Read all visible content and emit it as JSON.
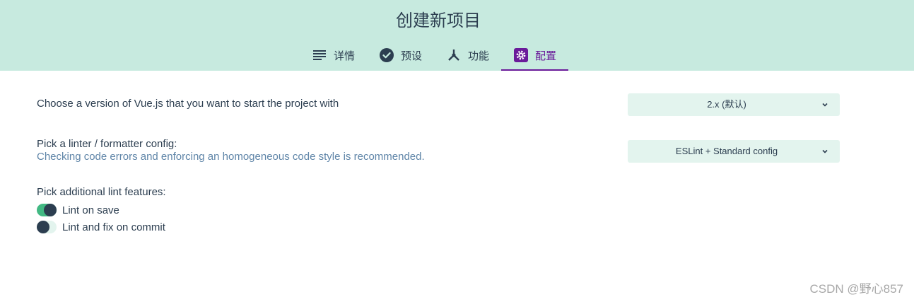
{
  "header": {
    "title": "创建新项目",
    "tabs": [
      {
        "label": "详情",
        "icon": "list-icon",
        "active": false
      },
      {
        "label": "预设",
        "icon": "check-circle-icon",
        "active": false
      },
      {
        "label": "功能",
        "icon": "merge-icon",
        "active": false
      },
      {
        "label": "配置",
        "icon": "gear-icon",
        "active": true
      }
    ]
  },
  "config": {
    "vue_version": {
      "label": "Choose a version of Vue.js that you want to start the project with",
      "selected": "2.x (默认)"
    },
    "linter": {
      "label": "Pick a linter / formatter config:",
      "description": "Checking code errors and enforcing an homogeneous code style is recommended.",
      "selected": "ESLint + Standard config"
    },
    "lint_features": {
      "label": "Pick additional lint features:",
      "options": [
        {
          "label": "Lint on save",
          "enabled": true
        },
        {
          "label": "Lint and fix on commit",
          "enabled": false
        }
      ]
    }
  },
  "watermark": "CSDN @野心857",
  "colors": {
    "header_bg": "#c7eadf",
    "accent": "#6a1b9a",
    "toggle_on": "#42b983",
    "select_bg": "#e3f4ee"
  }
}
